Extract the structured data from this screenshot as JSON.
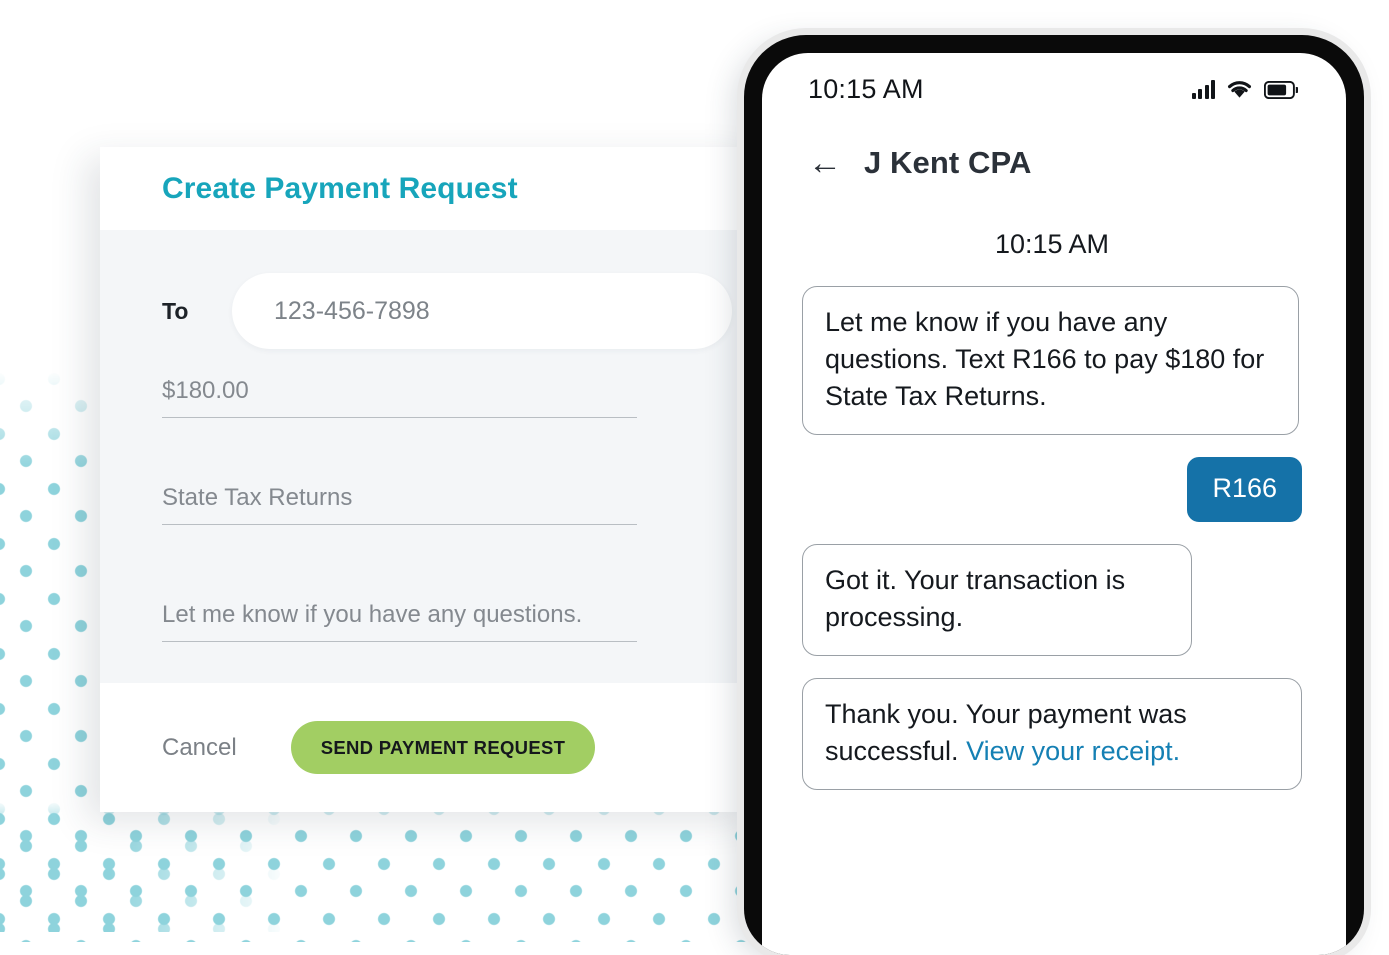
{
  "theme": {
    "accent_teal": "#17a5bb",
    "button_green": "#a2ce63",
    "bubble_blue": "#1572a8",
    "link_blue": "#1580b4",
    "dot_teal": "#8ed3dc"
  },
  "payment_card": {
    "title": "Create Payment Request",
    "to_label": "To",
    "to_value": "123-456-7898",
    "to_placeholder": "123-456-7898",
    "amount_value": "$180.00",
    "amount_placeholder": "$180.00",
    "description_value": "State Tax Returns",
    "description_placeholder": "State Tax Returns",
    "note_value": "Let me know if you have any questions.",
    "note_placeholder": "Let me know if you have any questions.",
    "cancel_label": "Cancel",
    "send_label": "SEND PAYMENT REQUEST"
  },
  "phone": {
    "statusbar": {
      "time": "10:15 AM",
      "signal_icon": "cellular-signal-icon",
      "wifi_icon": "wifi-icon",
      "battery_icon": "battery-icon"
    },
    "chat_header": {
      "back_icon": "←",
      "contact_name": "J Kent CPA"
    },
    "conversation": {
      "timestamp": "10:15 AM",
      "messages": [
        {
          "direction": "in",
          "text": "Let me know if you have any questions. Text R166 to pay $180 for State Tax Returns."
        },
        {
          "direction": "out",
          "text": "R166"
        },
        {
          "direction": "in",
          "text": "Got it. Your transaction is processing."
        },
        {
          "direction": "in",
          "text_before_link": "Thank you. Your payment was successful. ",
          "link_text": "View your receipt."
        }
      ]
    }
  }
}
